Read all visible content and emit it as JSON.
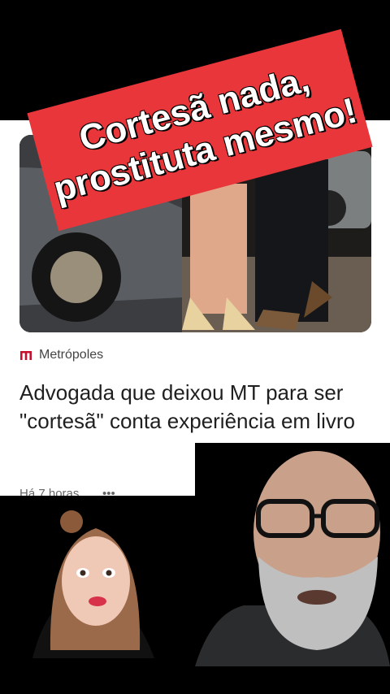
{
  "overlay": {
    "line1": "Cortesã nada,",
    "line2": "prostituta mesmo!",
    "color": "#e8363a"
  },
  "article": {
    "source_icon": "metropoles-logo-icon",
    "source": "Metrópoles",
    "headline": "Advogada que deixou MT para ser \"cortesã\" conta experiência em livro",
    "time": "Há 7 horas",
    "more": "•••"
  },
  "colors": {
    "card_bg": "#ffffff",
    "page_bg": "#000000",
    "brand_red": "#c8102e"
  }
}
